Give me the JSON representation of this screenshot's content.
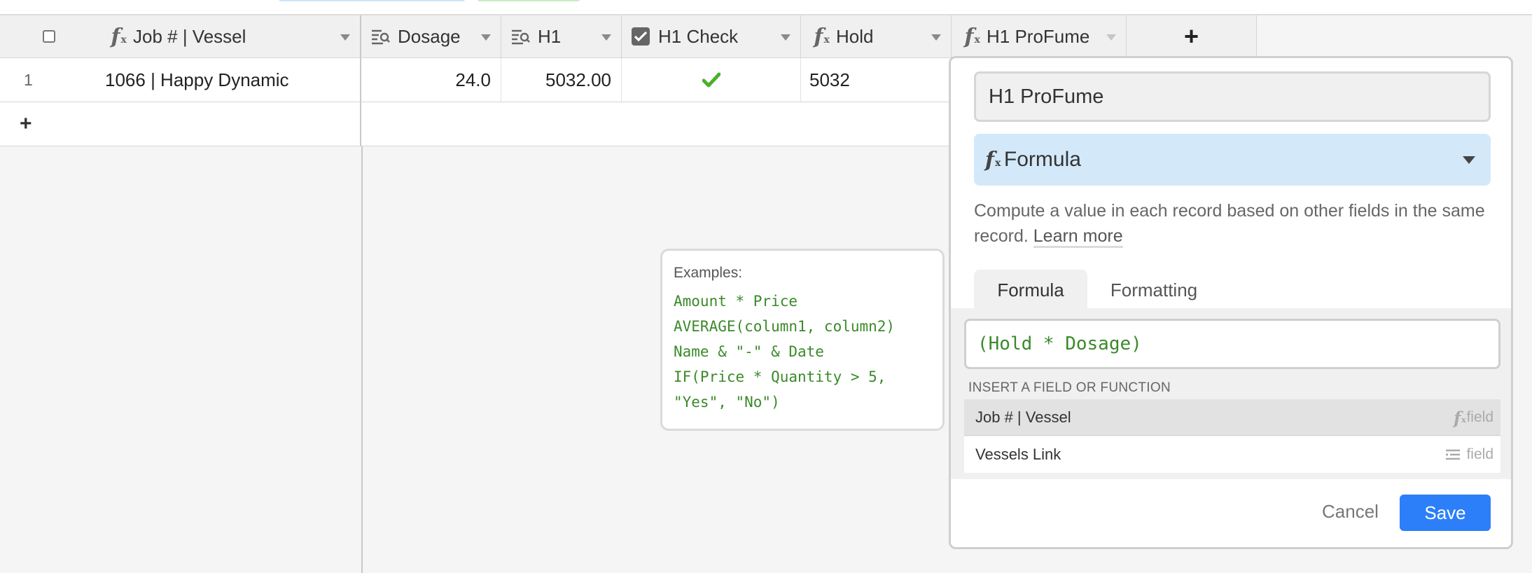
{
  "colors": {
    "accent": "#2d7ff9",
    "formula_green": "#3b8a2a",
    "type_bg": "#d3e9f9",
    "check_green": "#4caf2f"
  },
  "columns": [
    {
      "label": "Job # | Vessel",
      "icon": "formula-icon"
    },
    {
      "label": "Dosage",
      "icon": "lookup-icon"
    },
    {
      "label": "H1",
      "icon": "lookup-icon"
    },
    {
      "label": "H1 Check",
      "icon": "checkbox-icon"
    },
    {
      "label": "Hold",
      "icon": "formula-icon"
    },
    {
      "label": "H1 ProFume",
      "icon": "formula-icon"
    }
  ],
  "rows": [
    {
      "num": "1",
      "job_vessel": "1066 | Happy Dynamic",
      "dosage": "24.0",
      "h1": "5032.00",
      "h1_check": true,
      "hold": "5032"
    }
  ],
  "add_column_glyph": "+",
  "add_row_glyph": "+",
  "examples": {
    "label": "Examples:",
    "lines": [
      "Amount * Price",
      "AVERAGE(column1, column2)",
      "Name & \"-\" & Date",
      "IF(Price * Quantity > 5,",
      "\"Yes\", \"No\")"
    ]
  },
  "field_panel": {
    "name_value": "H1 ProFume",
    "type_label": "Formula",
    "description": "Compute a value in each record based on other fields in the same record.",
    "learn_more": "Learn more",
    "tabs": [
      "Formula",
      "Formatting"
    ],
    "formula": "(Hold * Dosage)",
    "insert_label": "INSERT A FIELD OR FUNCTION",
    "fields": [
      {
        "name": "Job # | Vessel",
        "type": "field",
        "icon": "formula-icon"
      },
      {
        "name": "Vessels Link",
        "type": "field",
        "icon": "link-list-icon"
      }
    ],
    "cancel_label": "Cancel",
    "save_label": "Save"
  }
}
